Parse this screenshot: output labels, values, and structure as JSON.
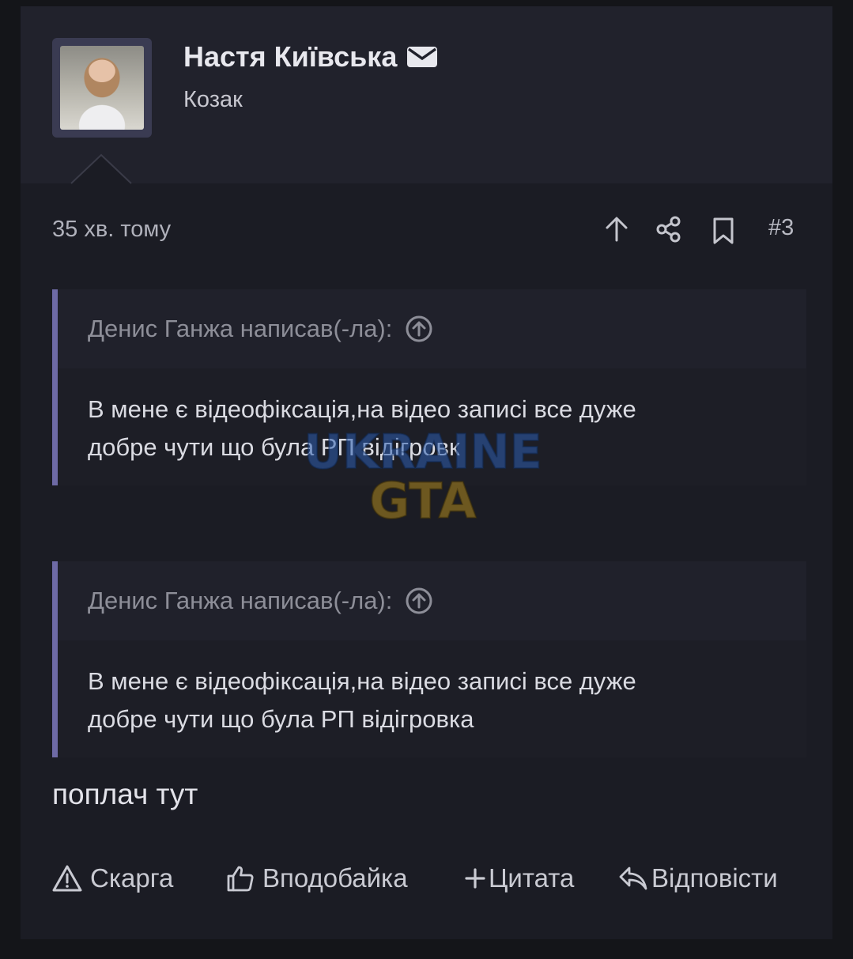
{
  "post": {
    "author": {
      "name": "Настя Київська",
      "title": "Козак"
    },
    "meta": {
      "time": "35 хв. тому",
      "number": "#3"
    },
    "quotes": [
      {
        "header": "Денис Ганжа написав(-ла):",
        "line1": "В мене є відеофіксація,на відео записі все дуже",
        "line2": "добре чути що була РП відігровк"
      },
      {
        "header": "Денис Ганжа написав(-ла):",
        "line1": "В мене є відеофіксація,на відео записі все дуже",
        "line2": "добре чути що була РП відігровка"
      }
    ],
    "message": "поплач тут",
    "actions": {
      "report": "Скарга",
      "like": "Вподобайка",
      "quote": "Цитата",
      "reply": "Відповісти"
    }
  },
  "watermark": {
    "line1": "UKRAINE",
    "line2": "GTA"
  },
  "colors": {
    "background": "#141519",
    "panel": "#1b1c24",
    "header": "#21222c",
    "quote_border": "#6e6aa5",
    "text": "#d9d9df"
  }
}
